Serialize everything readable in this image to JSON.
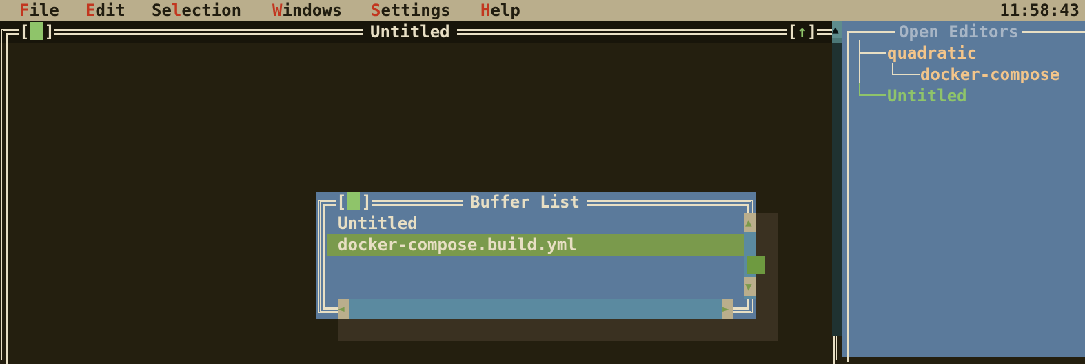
{
  "menu": {
    "items": [
      {
        "hotkey": "F",
        "rest": "ile"
      },
      {
        "hotkey": "E",
        "rest": "dit"
      },
      {
        "pre": "Se",
        "hotkey": "l",
        "rest": "ection"
      },
      {
        "hotkey": "W",
        "rest": "indows"
      },
      {
        "hotkey": "S",
        "rest": "ettings"
      },
      {
        "hotkey": "H",
        "rest": "elp"
      }
    ],
    "clock": "11:58:43"
  },
  "editor": {
    "title": "Untitled",
    "close_open": "[",
    "close_close": "]",
    "max_open": "[",
    "max_arrow": "↑",
    "max_close": "]",
    "scroll_up_glyph": "▲"
  },
  "open_editors": {
    "title": "Open Editors",
    "tree": [
      {
        "label": "quadratic",
        "color": "#f3c58a"
      },
      {
        "label": "docker-compose",
        "color": "#f3c58a"
      },
      {
        "label": "Untitled",
        "color": "#8fc46a"
      }
    ]
  },
  "buffer_list": {
    "title": "Buffer List",
    "close_open": "[",
    "close_close": "]",
    "items": [
      {
        "label": "Untitled",
        "selected": false
      },
      {
        "label": "docker-compose.build.yml",
        "selected": true
      }
    ],
    "scroll_up_glyph": "▲",
    "scroll_down_glyph": "▼",
    "scroll_left_glyph": "◄",
    "scroll_right_glyph": "►"
  },
  "colors": {
    "menu_bg": "#baae8c",
    "hotkey": "#c2361f",
    "editor_bg": "#241f0f",
    "panel_bg": "#5b7a9b",
    "selection": "#7a9a4c",
    "accent_green": "#8fc46a"
  }
}
